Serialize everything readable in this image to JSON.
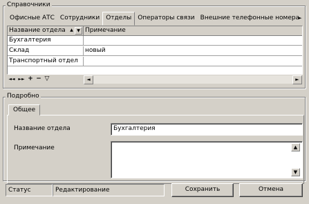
{
  "directory_group": {
    "title": "Справочники",
    "tabs": [
      {
        "label": "Офисные АТС"
      },
      {
        "label": "Сотрудники"
      },
      {
        "label": "Отделы"
      },
      {
        "label": "Операторы связи"
      },
      {
        "label": "Внешние телефонные номера"
      }
    ],
    "active_tab": "Отделы",
    "grid": {
      "columns": [
        "Название отдела",
        "Примечание"
      ],
      "rows": [
        {
          "name": "Бухгалтерия",
          "note": ""
        },
        {
          "name": "Склад",
          "note": "новый"
        },
        {
          "name": "Транспортный отдел",
          "note": ""
        }
      ]
    },
    "navigator": {
      "first": "◄◄",
      "last": "►►",
      "add": "+",
      "delete": "−",
      "filter": "▽"
    }
  },
  "details_group": {
    "title": "Подробно",
    "tab": "Общее",
    "fields": {
      "name_label": "Название отдела",
      "name_value": "Бухгалтерия",
      "note_label": "Примечание",
      "note_value": ""
    }
  },
  "status_bar": {
    "label": "Статус",
    "value": "Редактирование",
    "save_label": "Сохранить",
    "cancel_label": "Отмена"
  },
  "colors": {
    "face": "#d4d0c8",
    "shadow": "#808080",
    "highlight": "#ffffff",
    "field": "#ffffff"
  }
}
